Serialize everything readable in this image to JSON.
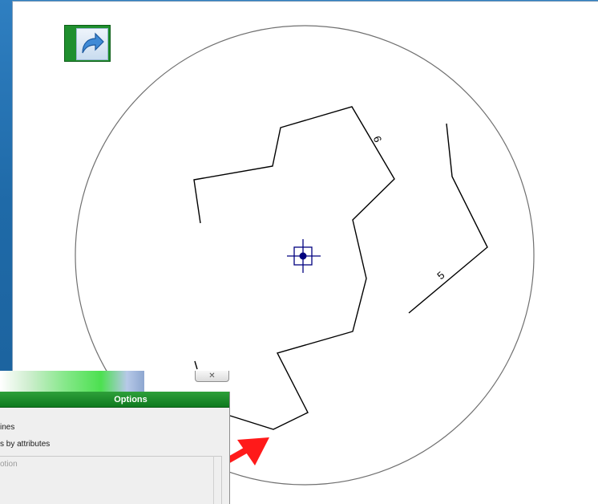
{
  "map": {
    "contour_labels": [
      "6",
      "5"
    ],
    "colors": {
      "background": "#ffffff",
      "contour": "#000000",
      "circle": "#707070",
      "crosshair": "#00007f",
      "arrow": "#ff1a1a",
      "nav_green": "#1f8f2e"
    }
  },
  "nav_button": {
    "icon": "forward-arrow-icon"
  },
  "options_dialog": {
    "close_glyph": "✕",
    "title": "Options",
    "items": [
      {
        "label": "ines"
      },
      {
        "label": "s by attributes"
      }
    ],
    "group_label": "otion"
  }
}
